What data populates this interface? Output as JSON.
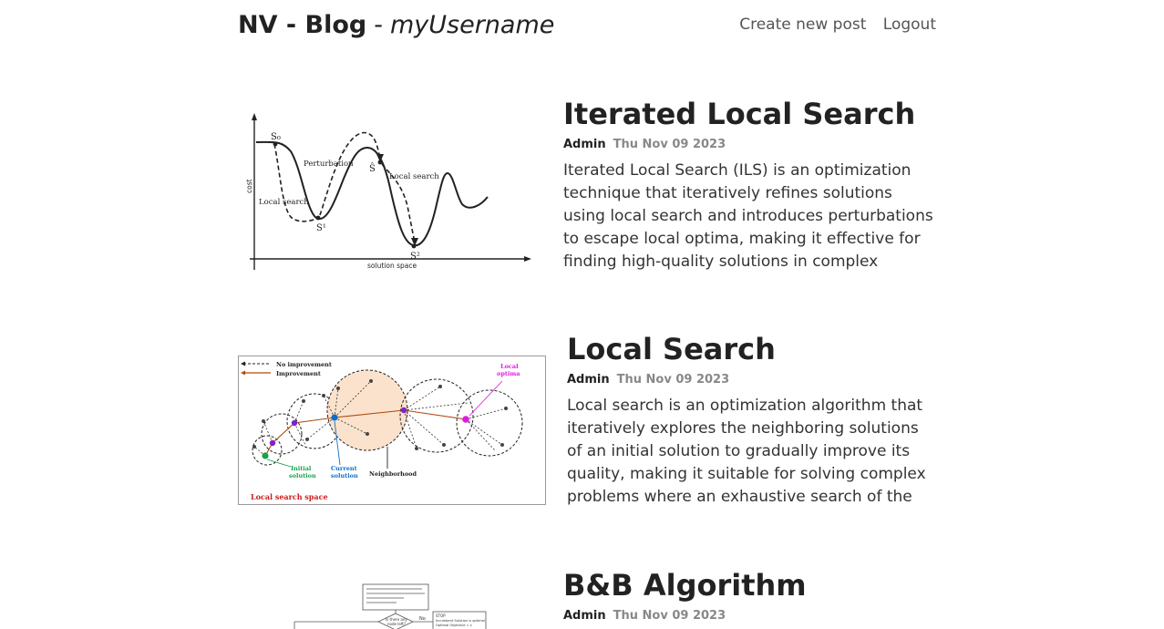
{
  "header": {
    "brand": "NV - Blog",
    "separator": "-",
    "username": "myUsername",
    "nav": [
      {
        "label": "Create new post"
      },
      {
        "label": "Logout"
      }
    ]
  },
  "posts": [
    {
      "title": "Iterated Local Search",
      "author": "Admin",
      "date": "Thu Nov 09 2023",
      "excerpt": "Iterated Local Search (ILS) is an optimization technique that iteratively refines solutions using local search and introduces perturbations to escape local optima, making it effective for finding high-quality solutions in complex optimization",
      "image_labels": {
        "s0": "S₀",
        "s1": "S¹",
        "s2": "S²",
        "s_hat": "Ŝ",
        "perturbation": "Perturbation",
        "local_search_left": "Local search",
        "local_search_right": "Local search",
        "y_axis": "cost",
        "x_axis": "solution space"
      }
    },
    {
      "title": "Local Search",
      "author": "Admin",
      "date": "Thu Nov 09 2023",
      "excerpt": "Local search is an optimization algorithm that iteratively explores the neighboring solutions of an initial solution to gradually improve its quality, making it suitable for solving complex problems where an exhaustive search of the solution space is",
      "image_labels": {
        "legend_no_improvement": "No improvement",
        "legend_improvement": "Improvement",
        "local_optima_1": "Local",
        "local_optima_2": "optima",
        "initial_1": "Initial",
        "initial_2": "solution",
        "current_1": "Current",
        "current_2": "solution",
        "neighborhood": "Neighborhood",
        "space": "Local search space"
      }
    },
    {
      "title": "B&B Algorithm",
      "author": "Admin",
      "date": "Thu Nov 09 2023",
      "excerpt": "",
      "image_labels": {
        "decision_1": "Is there any",
        "decision_2": "node left?",
        "no_label": "No",
        "stop_1": "STOP",
        "stop_2": "Incumbent Solution is optimal",
        "stop_3": "Optimal Objective = z"
      }
    }
  ]
}
